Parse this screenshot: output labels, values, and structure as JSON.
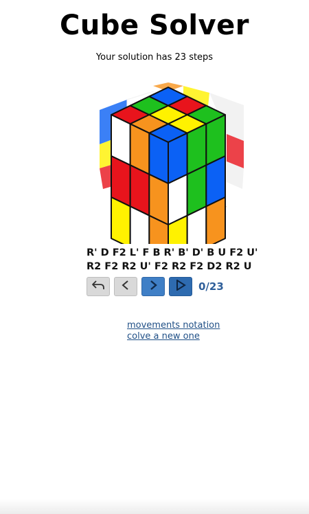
{
  "header": {
    "title": "Cube Solver",
    "subtitle": "Your solution has 23 steps"
  },
  "solution": {
    "line1": "R' D F2 L' F B R' B' D' B U F2 U'",
    "line2": "R2 F2 R2 U' F2 R2 F2 D2 R2 U",
    "counter": "0/23"
  },
  "controls": {
    "icons": [
      "undo-icon",
      "chevron-left-icon",
      "chevron-right-icon",
      "play-icon"
    ]
  },
  "links": {
    "notation": "movements notation",
    "new": "colve a new one"
  },
  "cube": {
    "colors": {
      "red": "#e8141c",
      "orange": "#f7931e",
      "yellow": "#fff200",
      "green": "#1ec01e",
      "blue": "#0b61f5",
      "white": "#ffffff"
    },
    "top": [
      "red",
      "green",
      "blue",
      "orange",
      "yellow",
      "red",
      "blue",
      "yellow",
      "green"
    ],
    "left": [
      "white",
      "orange",
      "blue",
      "red",
      "red",
      "orange",
      "yellow",
      "white",
      "orange"
    ],
    "right": [
      "blue",
      "green",
      "green",
      "white",
      "green",
      "blue",
      "yellow",
      "white",
      "orange"
    ],
    "front_left": [
      "yellow",
      "green",
      "green"
    ]
  }
}
